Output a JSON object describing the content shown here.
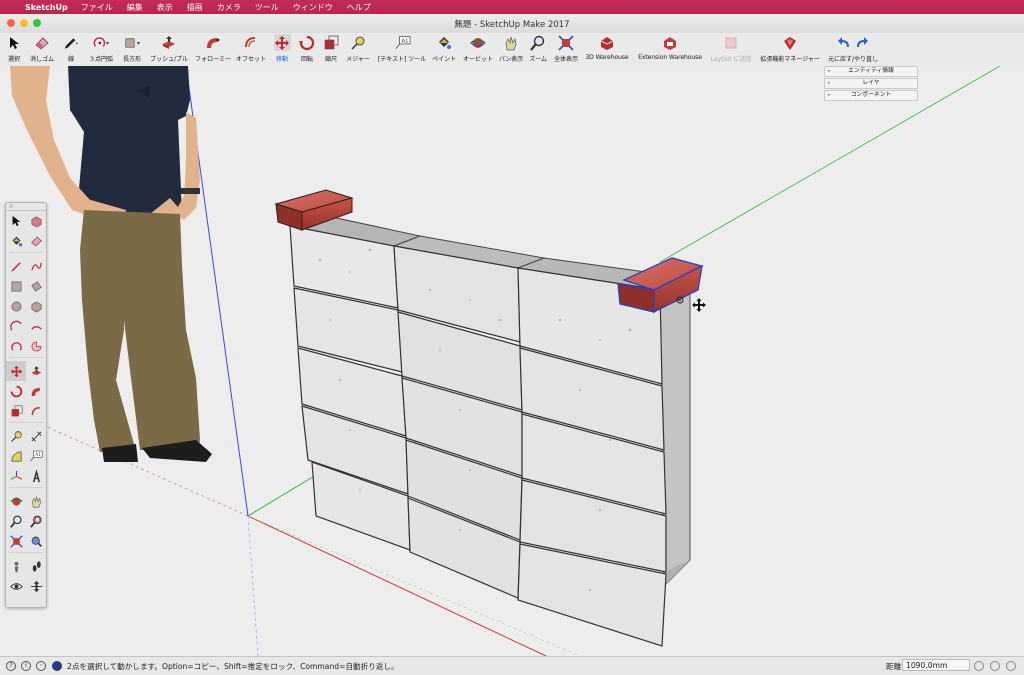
{
  "menubar": {
    "app": "SketchUp",
    "items": [
      "ファイル",
      "編集",
      "表示",
      "描画",
      "カメラ",
      "ツール",
      "ウィンドウ",
      "ヘルプ"
    ]
  },
  "window": {
    "title": "無題 - SketchUp Make 2017"
  },
  "toolbar": {
    "items": [
      {
        "label": "選択",
        "icon": "select-arrow-icon"
      },
      {
        "label": "消しゴム",
        "icon": "eraser-icon"
      },
      {
        "label": "線",
        "icon": "pencil-line-icon"
      },
      {
        "label": "３点円弧",
        "icon": "arc-icon"
      },
      {
        "label": "長方形",
        "icon": "rectangle-icon"
      },
      {
        "label": "プッシュ/プル",
        "icon": "push-pull-icon"
      },
      {
        "label": "フォローミー",
        "icon": "follow-me-icon"
      },
      {
        "label": "オフセット",
        "icon": "offset-icon"
      },
      {
        "label": "移動",
        "icon": "move-icon"
      },
      {
        "label": "回転",
        "icon": "rotate-icon"
      },
      {
        "label": "縮尺",
        "icon": "scale-icon"
      },
      {
        "label": "メジャー",
        "icon": "tape-measure-icon"
      },
      {
        "label": "[テキスト] ツール",
        "icon": "text-tool-icon"
      },
      {
        "label": "ペイント",
        "icon": "paint-bucket-icon"
      },
      {
        "label": "オービット",
        "icon": "orbit-icon"
      },
      {
        "label": "パン表示",
        "icon": "pan-hand-icon"
      },
      {
        "label": "ズーム",
        "icon": "zoom-icon"
      },
      {
        "label": "全体表示",
        "icon": "zoom-extents-icon"
      },
      {
        "label": "3D Warehouse",
        "icon": "3d-warehouse-icon"
      },
      {
        "label": "Extension Warehouse",
        "icon": "extension-warehouse-icon"
      },
      {
        "label": "LayOut に送信",
        "icon": "send-to-layout-icon"
      },
      {
        "label": "拡張機能マネージャー",
        "icon": "extension-manager-icon"
      },
      {
        "label": "元に戻す/やり直し",
        "icon": "undo-redo-icon"
      }
    ]
  },
  "trays": [
    "エンティティ情報",
    "レイヤ",
    "コンポーネント"
  ],
  "statusbar": {
    "message": "2点を選択して動かします。Option=コピー、Shift=推定をロック、Command=自動折り返し。",
    "distance_label": "距離",
    "distance_value": "1090.0mm"
  },
  "colors": {
    "menubar": "#bd2a55",
    "accent": "#1c66d8",
    "axis_red": "#d03a3a",
    "axis_green": "#3fae3f",
    "axis_blue": "#3a4ad8",
    "brick": "#c84a3e"
  }
}
